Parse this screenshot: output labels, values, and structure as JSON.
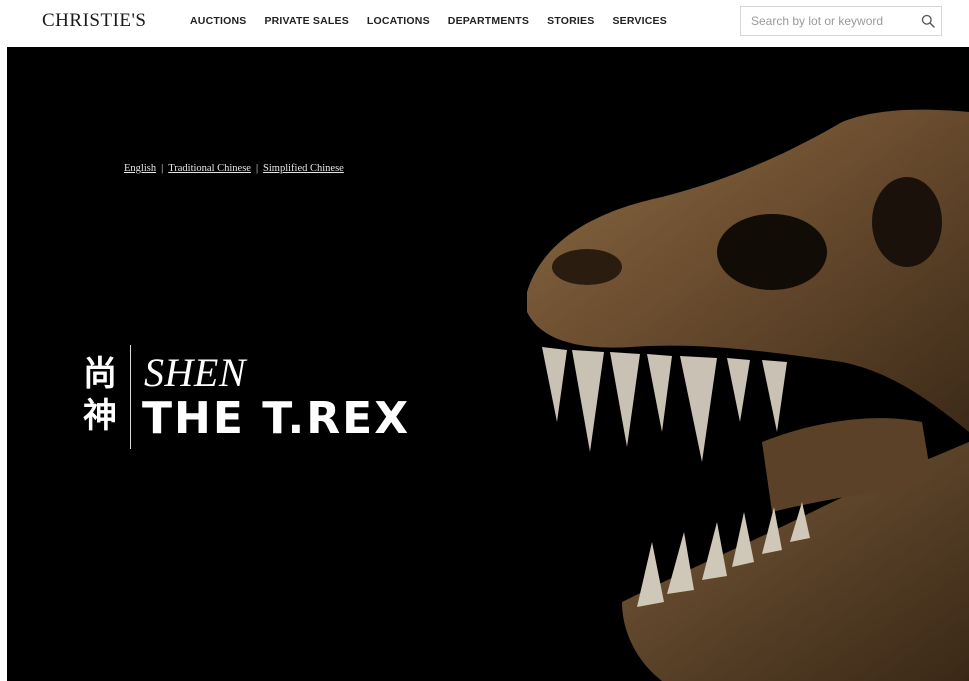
{
  "brand": {
    "logo_text": "CHRISTIE'S"
  },
  "nav": {
    "items": [
      {
        "label": "AUCTIONS"
      },
      {
        "label": "PRIVATE SALES"
      },
      {
        "label": "LOCATIONS"
      },
      {
        "label": "DEPARTMENTS"
      },
      {
        "label": "STORIES"
      },
      {
        "label": "SERVICES"
      }
    ]
  },
  "search": {
    "placeholder": "Search by lot or keyword",
    "value": "",
    "icon": "search-icon"
  },
  "hero": {
    "languages": [
      {
        "label": "English"
      },
      {
        "label": "Traditional Chinese"
      },
      {
        "label": "Simplified Chinese"
      }
    ],
    "separator": "|",
    "title_cjk_top": "尚",
    "title_cjk_bottom": "神",
    "title_italic": "SHEN",
    "title_main": "THE T.REX",
    "background_color": "#000000",
    "image": "trex-skull"
  }
}
